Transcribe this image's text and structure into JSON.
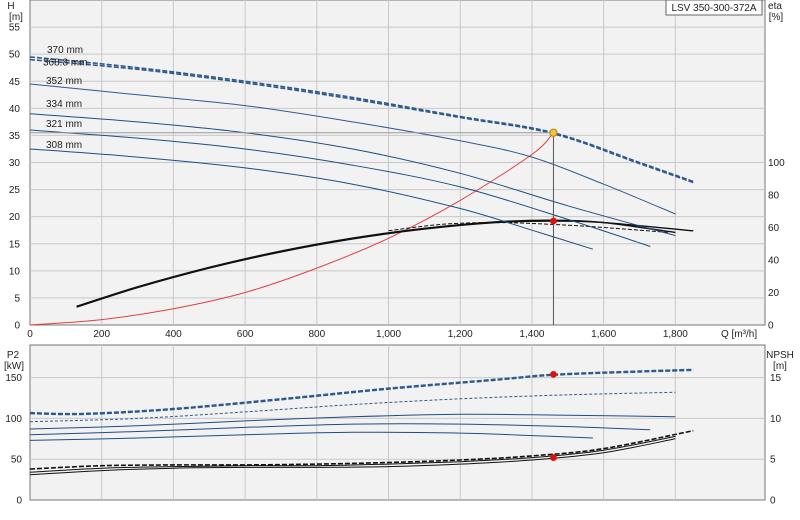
{
  "chart_data": [
    {
      "type": "line",
      "title": "LSV 350-300-372A",
      "xlabel": "Q [m³/h]",
      "ylabel": "H",
      "ylabel_unit": "[m]",
      "ylabel_right": "eta",
      "ylabel_right_unit": "[%]",
      "xlim": [
        0,
        2050
      ],
      "ylim": [
        0,
        60
      ],
      "ylim_right": [
        0,
        200
      ],
      "x_ticks": [
        0,
        200,
        400,
        600,
        800,
        1000,
        1200,
        1400,
        1600,
        1800
      ],
      "x_tick_labels": [
        "0",
        "200",
        "400",
        "600",
        "800",
        "1,000",
        "1,200",
        "1,400",
        "1,600",
        "1,800"
      ],
      "y_ticks": [
        0,
        5,
        10,
        15,
        20,
        25,
        30,
        35,
        40,
        45,
        50,
        55
      ],
      "y_right_ticks": [
        0,
        20,
        40,
        60,
        80,
        100
      ],
      "grid": true,
      "head_curves": [
        {
          "label": "370 mm",
          "x": [
            0,
            300,
            600,
            900,
            1200,
            1460,
            1700,
            1850
          ],
          "y": [
            49.5,
            47.5,
            45,
            42,
            38.5,
            35.5,
            30,
            26.5
          ],
          "style": "dashed-blue"
        },
        {
          "label": "368.8 mm",
          "x": [
            0,
            300,
            600,
            900,
            1200,
            1460,
            1700,
            1850
          ],
          "y": [
            49.0,
            47.2,
            44.7,
            41.7,
            38.3,
            35.3,
            29.8,
            26.3
          ],
          "style": "dashed-blue"
        },
        {
          "label": "352 mm",
          "x": [
            0,
            300,
            600,
            900,
            1200,
            1400,
            1600,
            1800
          ],
          "y": [
            44.5,
            42.5,
            40.5,
            37.5,
            34,
            31,
            26,
            20.5
          ],
          "style": "solid-dashed-blue"
        },
        {
          "label": "334 mm",
          "x": [
            0,
            300,
            600,
            900,
            1200,
            1500,
            1800
          ],
          "y": [
            39,
            37.5,
            35.5,
            32.5,
            28,
            22,
            16.5
          ],
          "style": "solid-blue"
        },
        {
          "label": "321 mm",
          "x": [
            0,
            300,
            600,
            900,
            1200,
            1500,
            1730
          ],
          "y": [
            36,
            34.5,
            32.5,
            29.5,
            25.5,
            19.5,
            14.5
          ],
          "style": "solid-blue"
        },
        {
          "label": "308 mm",
          "x": [
            0,
            300,
            600,
            900,
            1200,
            1400,
            1570
          ],
          "y": [
            32.5,
            31,
            29,
            26,
            21.5,
            17.5,
            14
          ],
          "style": "solid-blue"
        }
      ],
      "system_curve": {
        "x": [
          0,
          200,
          400,
          600,
          800,
          1000,
          1200,
          1400,
          1460
        ],
        "y": [
          0,
          1,
          3,
          6,
          10.5,
          16,
          23,
          31.5,
          35.5
        ]
      },
      "efficiency_curves": [
        {
          "x": [
            130,
            300,
            500,
            700,
            900,
            1100,
            1300,
            1460,
            1600,
            1850
          ],
          "y": [
            11,
            23,
            35,
            45,
            53,
            59,
            63,
            64,
            63,
            58
          ]
        },
        {
          "x": [
            130,
            300,
            500,
            700,
            900,
            1100,
            1300,
            1460,
            1600,
            1800
          ],
          "y": [
            11.5,
            23.5,
            35.5,
            45.5,
            53.5,
            59.5,
            63.5,
            64.5,
            63,
            57
          ]
        },
        {
          "x": [
            1000,
            1150,
            1300,
            1450,
            1600,
            1780
          ],
          "y": [
            58,
            62,
            63,
            62,
            60,
            57
          ]
        }
      ],
      "duty_point": {
        "x": 1460,
        "head": 35.5,
        "eta": 64
      }
    },
    {
      "type": "line",
      "ylabel": "P2",
      "ylabel_unit": "[kW]",
      "ylabel_right": "NPSH",
      "ylabel_right_unit": "[m]",
      "xlim": [
        0,
        2050
      ],
      "ylim": [
        0,
        190
      ],
      "ylim_right": [
        0,
        19
      ],
      "y_ticks": [
        0,
        50,
        100,
        150
      ],
      "y_right_ticks": [
        0,
        5,
        10,
        15
      ],
      "grid": true,
      "power_curves": [
        {
          "label": "370 mm",
          "x": [
            0,
            150,
            400,
            700,
            1000,
            1300,
            1460,
            1700,
            1850
          ],
          "y": [
            107,
            106,
            112,
            124,
            137,
            148,
            154,
            158,
            160
          ],
          "style": "dashed-blue"
        },
        {
          "label": "368.8 mm",
          "x": [
            0,
            150,
            400,
            700,
            1000,
            1300,
            1460,
            1700,
            1850
          ],
          "y": [
            106,
            105,
            111,
            123,
            136,
            147,
            153,
            157,
            159
          ],
          "style": "dashed-blue"
        },
        {
          "label": "352 mm",
          "x": [
            0,
            300,
            600,
            900,
            1200,
            1500,
            1800
          ],
          "y": [
            96,
            100,
            108,
            117,
            124,
            129,
            132
          ],
          "style": "dotted-blue"
        },
        {
          "label": "334 mm",
          "x": [
            0,
            300,
            600,
            900,
            1200,
            1500,
            1800
          ],
          "y": [
            87,
            91,
            97,
            102,
            105,
            104,
            102
          ],
          "style": "solid-blue"
        },
        {
          "label": "321 mm",
          "x": [
            0,
            300,
            600,
            900,
            1200,
            1500,
            1730
          ],
          "y": [
            80,
            84,
            89,
            93,
            93,
            90,
            86
          ],
          "style": "solid-blue"
        },
        {
          "label": "308 mm",
          "x": [
            0,
            300,
            600,
            900,
            1200,
            1400,
            1570
          ],
          "y": [
            73,
            76,
            80,
            83,
            82,
            79,
            76
          ],
          "style": "solid-blue"
        }
      ],
      "npsh_curves": [
        {
          "x": [
            0,
            200,
            400,
            600,
            800,
            1000,
            1200,
            1400,
            1600,
            1850
          ],
          "y": [
            3.8,
            4.2,
            4.3,
            4.3,
            4.4,
            4.6,
            4.9,
            5.4,
            6.3,
            8.5
          ]
        },
        {
          "x": [
            0,
            200,
            400,
            600,
            800,
            1000,
            1200,
            1400,
            1600,
            1800
          ],
          "y": [
            3.4,
            3.9,
            4.1,
            4.2,
            4.2,
            4.4,
            4.7,
            5.2,
            6.1,
            7.8
          ]
        },
        {
          "x": [
            0,
            200,
            400,
            600,
            800,
            1000,
            1200,
            1400,
            1600,
            1800
          ],
          "y": [
            3.1,
            3.6,
            3.9,
            4.0,
            4.0,
            4.1,
            4.4,
            4.9,
            5.8,
            7.5
          ]
        }
      ],
      "duty_point": {
        "x": 1460,
        "power": 154,
        "npsh": 5.2
      }
    }
  ]
}
